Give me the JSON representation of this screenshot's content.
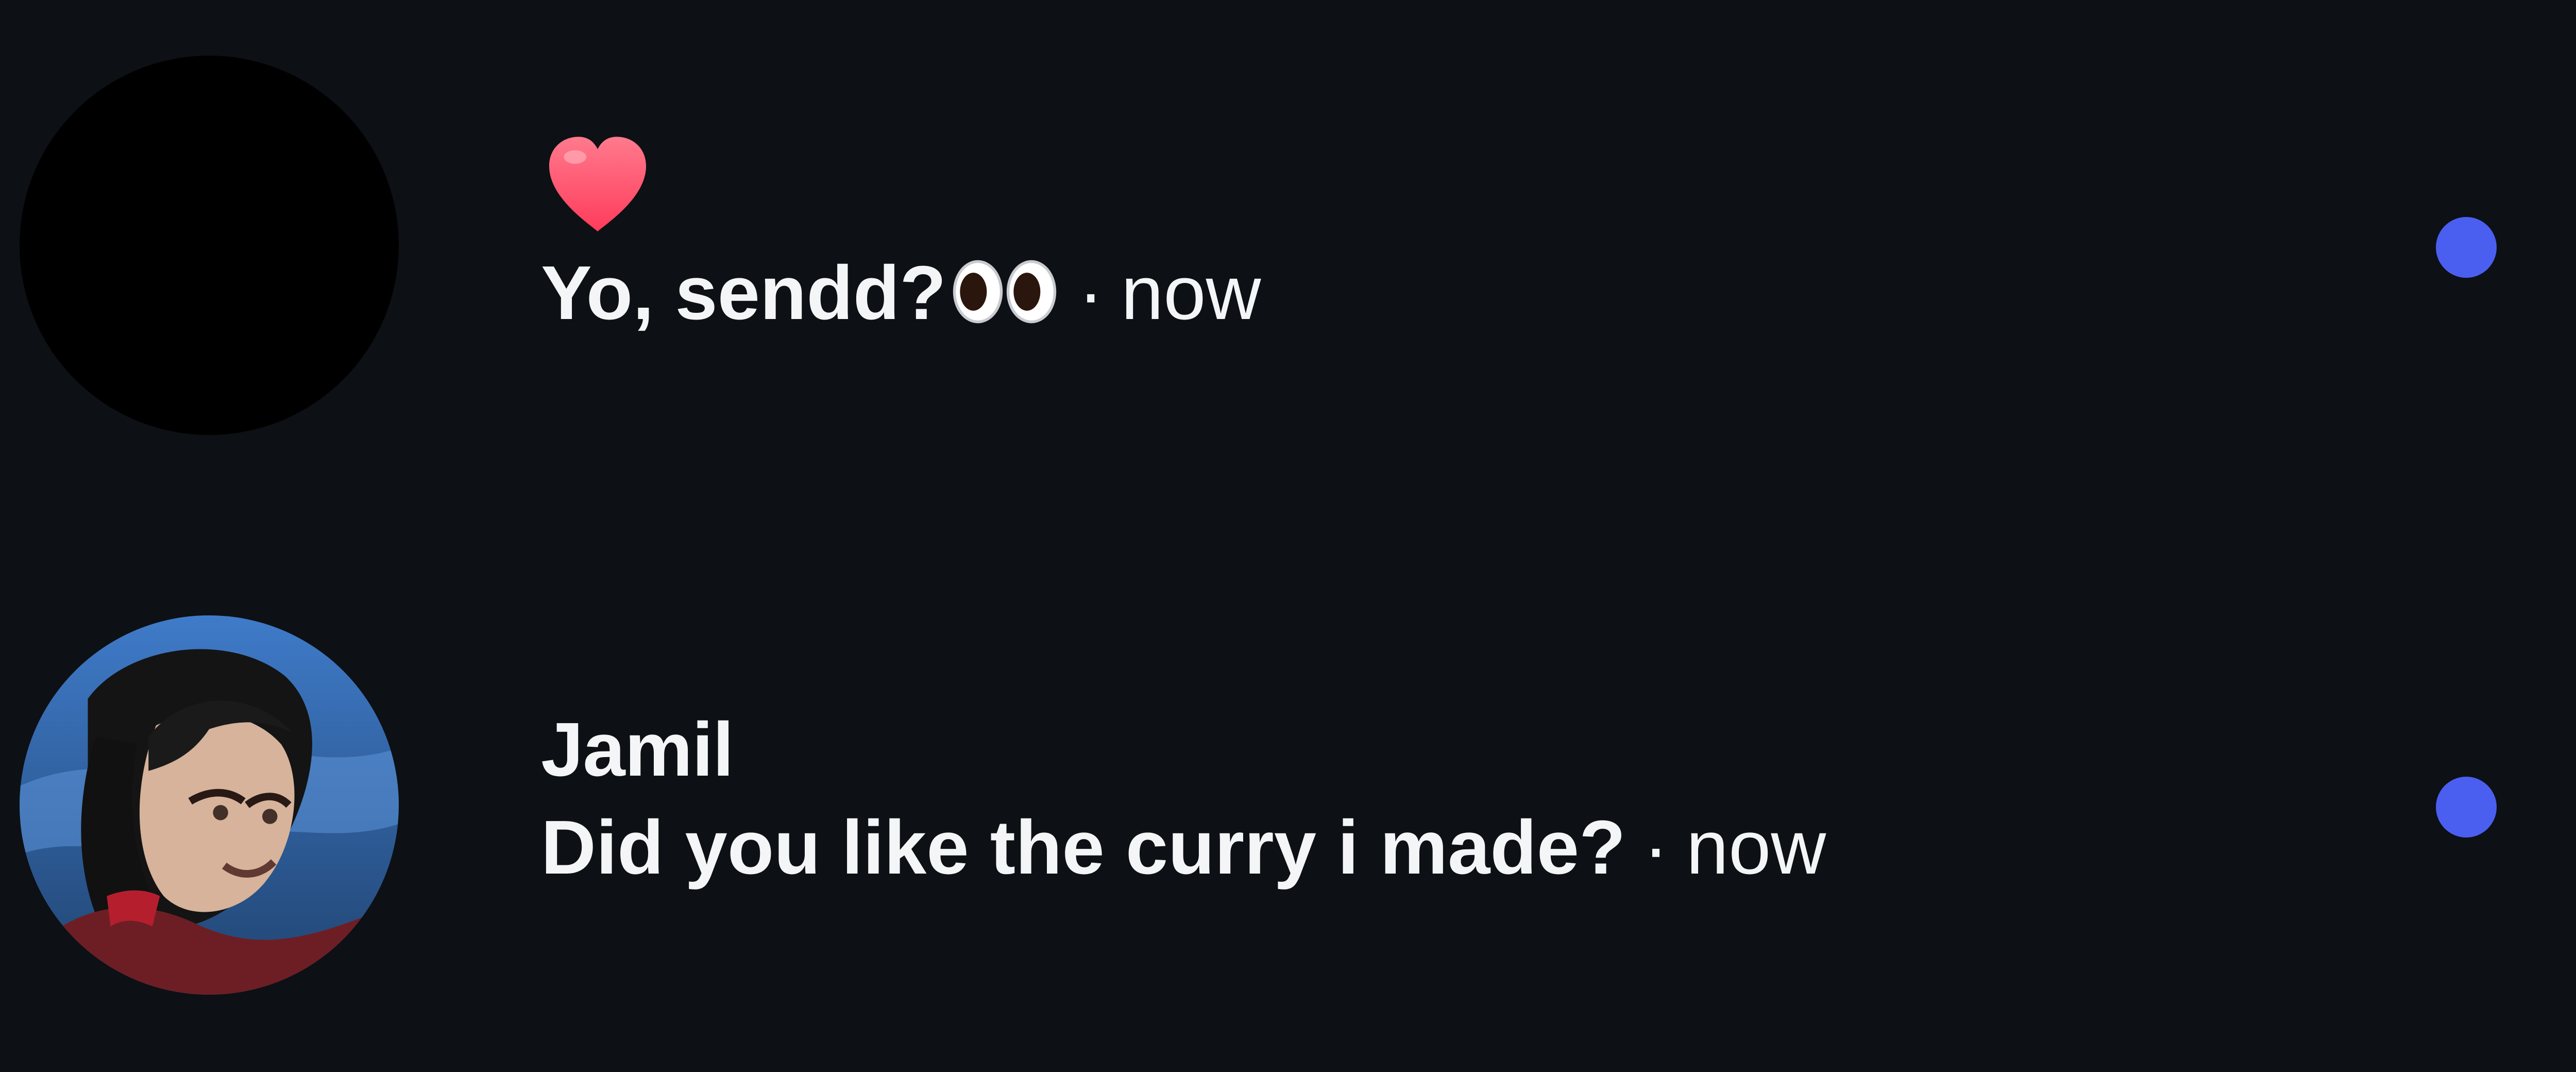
{
  "colors": {
    "background": "#0d1014",
    "text": "#f4f5f7",
    "unread_dot": "#4a5ff0",
    "reaction_heart": "#ff4d67"
  },
  "threads": [
    {
      "avatar": "black-profile-photo",
      "reaction": "heart-emoji",
      "sender": "",
      "message": "Yo, sendd?",
      "message_emoji": "eyes-emoji",
      "separator": "·",
      "timestamp": "now",
      "unread": true
    },
    {
      "avatar": "jamil-profile-photo",
      "sender": "Jamil",
      "message": "Did you like the curry i made?",
      "separator": "·",
      "timestamp": "now",
      "unread": true
    }
  ]
}
